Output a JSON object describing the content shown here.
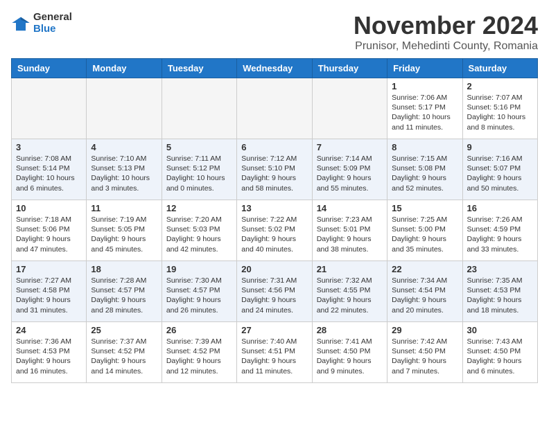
{
  "logo": {
    "general": "General",
    "blue": "Blue"
  },
  "header": {
    "month": "November 2024",
    "location": "Prunisor, Mehedinti County, Romania"
  },
  "weekdays": [
    "Sunday",
    "Monday",
    "Tuesday",
    "Wednesday",
    "Thursday",
    "Friday",
    "Saturday"
  ],
  "weeks": [
    [
      {
        "day": "",
        "info": ""
      },
      {
        "day": "",
        "info": ""
      },
      {
        "day": "",
        "info": ""
      },
      {
        "day": "",
        "info": ""
      },
      {
        "day": "",
        "info": ""
      },
      {
        "day": "1",
        "info": "Sunrise: 7:06 AM\nSunset: 5:17 PM\nDaylight: 10 hours and 11 minutes."
      },
      {
        "day": "2",
        "info": "Sunrise: 7:07 AM\nSunset: 5:16 PM\nDaylight: 10 hours and 8 minutes."
      }
    ],
    [
      {
        "day": "3",
        "info": "Sunrise: 7:08 AM\nSunset: 5:14 PM\nDaylight: 10 hours and 6 minutes."
      },
      {
        "day": "4",
        "info": "Sunrise: 7:10 AM\nSunset: 5:13 PM\nDaylight: 10 hours and 3 minutes."
      },
      {
        "day": "5",
        "info": "Sunrise: 7:11 AM\nSunset: 5:12 PM\nDaylight: 10 hours and 0 minutes."
      },
      {
        "day": "6",
        "info": "Sunrise: 7:12 AM\nSunset: 5:10 PM\nDaylight: 9 hours and 58 minutes."
      },
      {
        "day": "7",
        "info": "Sunrise: 7:14 AM\nSunset: 5:09 PM\nDaylight: 9 hours and 55 minutes."
      },
      {
        "day": "8",
        "info": "Sunrise: 7:15 AM\nSunset: 5:08 PM\nDaylight: 9 hours and 52 minutes."
      },
      {
        "day": "9",
        "info": "Sunrise: 7:16 AM\nSunset: 5:07 PM\nDaylight: 9 hours and 50 minutes."
      }
    ],
    [
      {
        "day": "10",
        "info": "Sunrise: 7:18 AM\nSunset: 5:06 PM\nDaylight: 9 hours and 47 minutes."
      },
      {
        "day": "11",
        "info": "Sunrise: 7:19 AM\nSunset: 5:05 PM\nDaylight: 9 hours and 45 minutes."
      },
      {
        "day": "12",
        "info": "Sunrise: 7:20 AM\nSunset: 5:03 PM\nDaylight: 9 hours and 42 minutes."
      },
      {
        "day": "13",
        "info": "Sunrise: 7:22 AM\nSunset: 5:02 PM\nDaylight: 9 hours and 40 minutes."
      },
      {
        "day": "14",
        "info": "Sunrise: 7:23 AM\nSunset: 5:01 PM\nDaylight: 9 hours and 38 minutes."
      },
      {
        "day": "15",
        "info": "Sunrise: 7:25 AM\nSunset: 5:00 PM\nDaylight: 9 hours and 35 minutes."
      },
      {
        "day": "16",
        "info": "Sunrise: 7:26 AM\nSunset: 4:59 PM\nDaylight: 9 hours and 33 minutes."
      }
    ],
    [
      {
        "day": "17",
        "info": "Sunrise: 7:27 AM\nSunset: 4:58 PM\nDaylight: 9 hours and 31 minutes."
      },
      {
        "day": "18",
        "info": "Sunrise: 7:28 AM\nSunset: 4:57 PM\nDaylight: 9 hours and 28 minutes."
      },
      {
        "day": "19",
        "info": "Sunrise: 7:30 AM\nSunset: 4:57 PM\nDaylight: 9 hours and 26 minutes."
      },
      {
        "day": "20",
        "info": "Sunrise: 7:31 AM\nSunset: 4:56 PM\nDaylight: 9 hours and 24 minutes."
      },
      {
        "day": "21",
        "info": "Sunrise: 7:32 AM\nSunset: 4:55 PM\nDaylight: 9 hours and 22 minutes."
      },
      {
        "day": "22",
        "info": "Sunrise: 7:34 AM\nSunset: 4:54 PM\nDaylight: 9 hours and 20 minutes."
      },
      {
        "day": "23",
        "info": "Sunrise: 7:35 AM\nSunset: 4:53 PM\nDaylight: 9 hours and 18 minutes."
      }
    ],
    [
      {
        "day": "24",
        "info": "Sunrise: 7:36 AM\nSunset: 4:53 PM\nDaylight: 9 hours and 16 minutes."
      },
      {
        "day": "25",
        "info": "Sunrise: 7:37 AM\nSunset: 4:52 PM\nDaylight: 9 hours and 14 minutes."
      },
      {
        "day": "26",
        "info": "Sunrise: 7:39 AM\nSunset: 4:52 PM\nDaylight: 9 hours and 12 minutes."
      },
      {
        "day": "27",
        "info": "Sunrise: 7:40 AM\nSunset: 4:51 PM\nDaylight: 9 hours and 11 minutes."
      },
      {
        "day": "28",
        "info": "Sunrise: 7:41 AM\nSunset: 4:50 PM\nDaylight: 9 hours and 9 minutes."
      },
      {
        "day": "29",
        "info": "Sunrise: 7:42 AM\nSunset: 4:50 PM\nDaylight: 9 hours and 7 minutes."
      },
      {
        "day": "30",
        "info": "Sunrise: 7:43 AM\nSunset: 4:50 PM\nDaylight: 9 hours and 6 minutes."
      }
    ]
  ]
}
